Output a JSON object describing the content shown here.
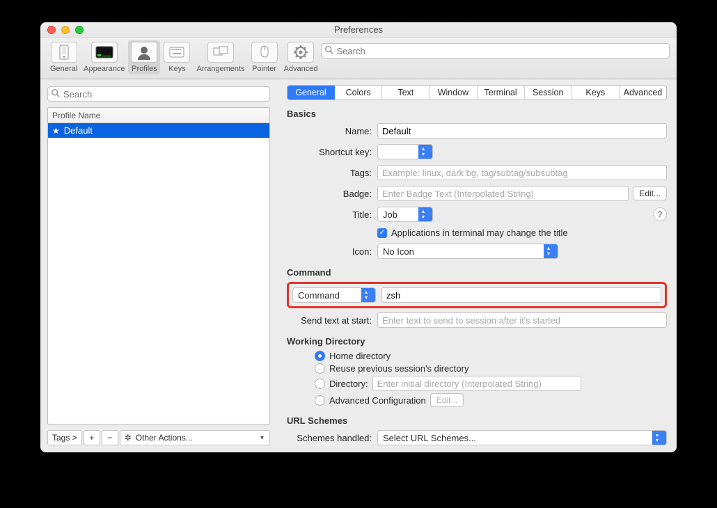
{
  "window": {
    "title": "Preferences",
    "search_placeholder": "Search"
  },
  "toolbar": {
    "items": [
      {
        "label": "General"
      },
      {
        "label": "Appearance"
      },
      {
        "label": "Profiles"
      },
      {
        "label": "Keys"
      },
      {
        "label": "Arrangements"
      },
      {
        "label": "Pointer"
      },
      {
        "label": "Advanced"
      }
    ]
  },
  "sidebar": {
    "search_placeholder": "Search",
    "col_header": "Profile Name",
    "profiles": [
      {
        "name": "Default",
        "starred": true
      }
    ],
    "footer": {
      "tags": "Tags >",
      "plus": "+",
      "minus": "−",
      "actions": "Other Actions..."
    }
  },
  "tabs": [
    {
      "label": "General",
      "active": true
    },
    {
      "label": "Colors"
    },
    {
      "label": "Text"
    },
    {
      "label": "Window"
    },
    {
      "label": "Terminal"
    },
    {
      "label": "Session"
    },
    {
      "label": "Keys"
    },
    {
      "label": "Advanced"
    }
  ],
  "sections": {
    "basics": {
      "heading": "Basics",
      "name_label": "Name:",
      "name_value": "Default",
      "shortcut_label": "Shortcut key:",
      "tags_label": "Tags:",
      "tags_placeholder": "Example: linux, dark bg, tag/subtag/subsubtag",
      "badge_label": "Badge:",
      "badge_placeholder": "Enter Badge Text (Interpolated String)",
      "edit_btn": "Edit...",
      "title_label": "Title:",
      "title_value": "Job",
      "title_cb_label": "Applications in terminal may change the title",
      "icon_label": "Icon:",
      "icon_value": "No Icon"
    },
    "command": {
      "heading": "Command",
      "mode": "Command",
      "value": "zsh",
      "send_label": "Send text at start:",
      "send_placeholder": "Enter text to send to session after it's started"
    },
    "workdir": {
      "heading": "Working Directory",
      "r0": "Home directory",
      "r1": "Reuse previous session's directory",
      "r2": "Directory:",
      "r2_placeholder": "Enter initial directory (Interpolated String)",
      "r3": "Advanced Configuration",
      "edit_btn": "Edit..."
    },
    "url": {
      "heading": "URL Schemes",
      "label": "Schemes handled:",
      "value": "Select URL Schemes..."
    }
  }
}
